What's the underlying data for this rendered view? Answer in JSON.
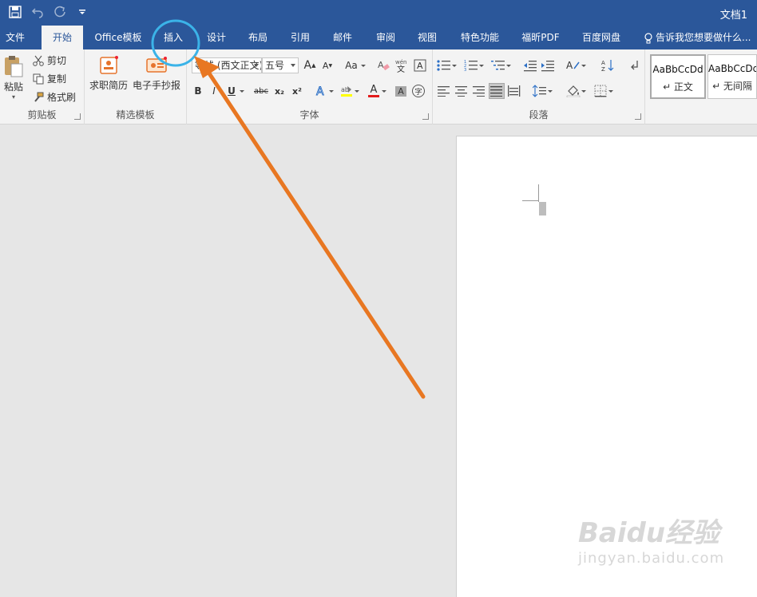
{
  "window": {
    "doc_title": "文档1"
  },
  "qat": {
    "save_icon": "save-icon",
    "undo_icon": "undo-icon",
    "redo_icon": "redo-icon",
    "customize_icon": "customize-qat-icon"
  },
  "tabs": [
    {
      "label": "文件"
    },
    {
      "label": "开始"
    },
    {
      "label": "Office模板"
    },
    {
      "label": "插入"
    },
    {
      "label": "设计"
    },
    {
      "label": "布局"
    },
    {
      "label": "引用"
    },
    {
      "label": "邮件"
    },
    {
      "label": "审阅"
    },
    {
      "label": "视图"
    },
    {
      "label": "特色功能"
    },
    {
      "label": "福昕PDF"
    },
    {
      "label": "百度网盘"
    }
  ],
  "tell_me": "告诉我您想要做什么...",
  "clipboard": {
    "group_label": "剪贴板",
    "paste": "粘贴",
    "cut": "剪切",
    "copy": "复制",
    "format_painter": "格式刷"
  },
  "templates": {
    "group_label": "精选模板",
    "resume": "求职简历",
    "handwritten": "电子手抄报"
  },
  "font": {
    "group_label": "字体",
    "font_name": "等线 (西文正文)",
    "font_size": "五号",
    "grow": "A",
    "shrink": "A",
    "change_case": "Aa",
    "bold": "B",
    "italic": "I",
    "underline": "U",
    "strike": "abc",
    "sub": "x₂",
    "sup": "x²",
    "font_color": "A",
    "char_shading": "A",
    "enclose": "字"
  },
  "paragraph": {
    "group_label": "段落"
  },
  "styles": [
    {
      "sample": "AaBbCcDd",
      "name": "↵ 正文"
    },
    {
      "sample": "AaBbCcDd",
      "name": "↵ 无间隔"
    }
  ],
  "watermark": {
    "line1": "Baidu经验",
    "line2": "jingyan.baidu.com"
  },
  "colors": {
    "accent": "#2b579a",
    "annotation_arrow": "#e87722",
    "annotation_circle": "#3bb3e8"
  }
}
